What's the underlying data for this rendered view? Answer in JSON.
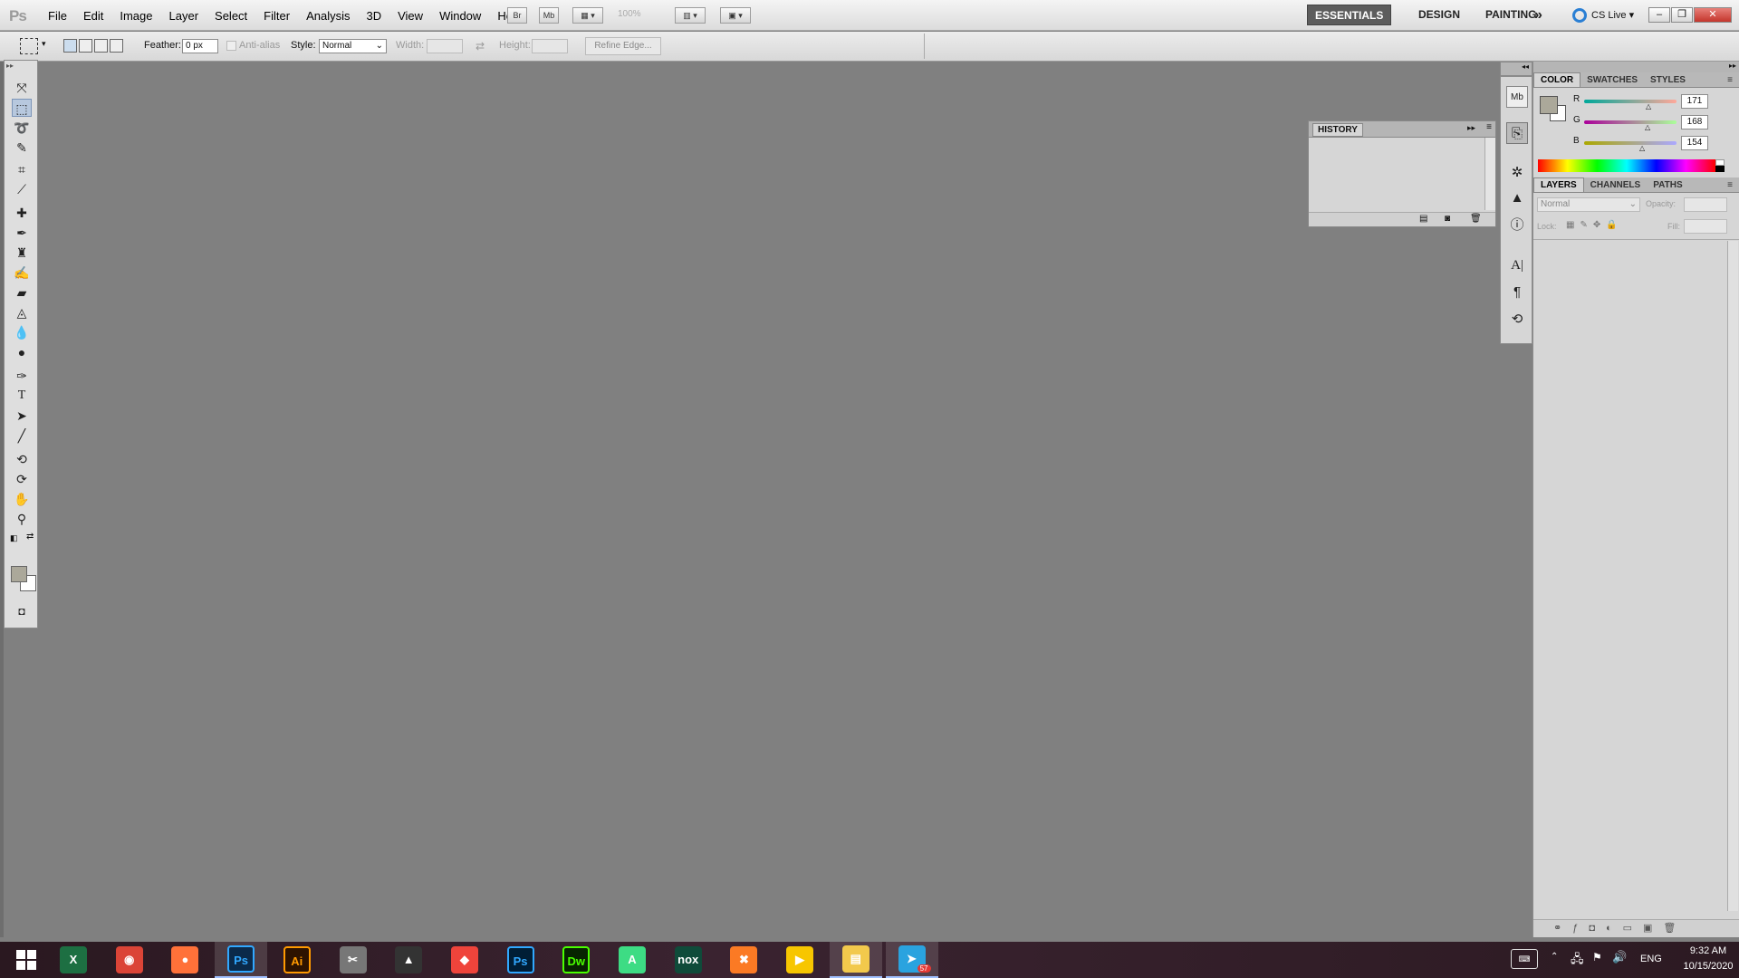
{
  "app": {
    "logo": "Ps"
  },
  "menu": [
    "File",
    "Edit",
    "Image",
    "Layer",
    "Select",
    "Filter",
    "Analysis",
    "3D",
    "View",
    "Window",
    "Help"
  ],
  "menubar_buttons": {
    "bridge": "Br",
    "mini_bridge": "Mb",
    "zoom": "100%"
  },
  "workspaces": {
    "essentials": "ESSENTIALS",
    "design": "DESIGN",
    "painting": "PAINTING",
    "more": "»",
    "cslive": "CS Live"
  },
  "options": {
    "feather_label": "Feather:",
    "feather_value": "0 px",
    "antialias_label": "Anti-alias",
    "style_label": "Style:",
    "style_value": "Normal",
    "width_label": "Width:",
    "height_label": "Height:",
    "refine_edge": "Refine Edge..."
  },
  "history_panel": {
    "title": "HISTORY"
  },
  "color_panel": {
    "tabs": [
      "COLOR",
      "SWATCHES",
      "STYLES"
    ],
    "channels": [
      {
        "label": "R",
        "value": "171"
      },
      {
        "label": "G",
        "value": "168"
      },
      {
        "label": "B",
        "value": "154"
      }
    ],
    "foreground": "#aba89a",
    "background": "#ffffff"
  },
  "layers_panel": {
    "tabs": [
      "LAYERS",
      "CHANNELS",
      "PATHS"
    ],
    "blend_mode": "Normal",
    "opacity_label": "Opacity:",
    "lock_label": "Lock:",
    "fill_label": "Fill:"
  },
  "taskbar": {
    "apps": [
      {
        "name": "Excel",
        "icon": "X",
        "color": "#1d6f42"
      },
      {
        "name": "Chrome",
        "icon": "◉",
        "color": "#db4437"
      },
      {
        "name": "Firefox",
        "icon": "●",
        "color": "#ff7139"
      },
      {
        "name": "Photoshop",
        "icon": "Ps",
        "color": "#0b2a4a"
      },
      {
        "name": "Illustrator",
        "icon": "Ai",
        "color": "#2d1300"
      },
      {
        "name": "Snipping Tool",
        "icon": "✂",
        "color": "#777777"
      },
      {
        "name": "Lighthouse",
        "icon": "▲",
        "color": "#333333"
      },
      {
        "name": "AnyDesk",
        "icon": "◆",
        "color": "#ef443b"
      },
      {
        "name": "Photoshop",
        "icon": "Ps",
        "color": "#001e36"
      },
      {
        "name": "Dreamweaver",
        "icon": "Dw",
        "color": "#072401"
      },
      {
        "name": "Android Studio",
        "icon": "A",
        "color": "#3ddc84"
      },
      {
        "name": "Nox",
        "icon": "nox",
        "color": "#0f4b3a"
      },
      {
        "name": "XAMPP",
        "icon": "✖",
        "color": "#fb7a24"
      },
      {
        "name": "Media Player",
        "icon": "▶",
        "color": "#f7c600"
      },
      {
        "name": "File Explorer",
        "icon": "▤",
        "color": "#f2c94c"
      },
      {
        "name": "Telegram",
        "icon": "➤",
        "color": "#2aa3df"
      }
    ],
    "telegram_badge": "57",
    "lang": "ENG",
    "time": "9:32 AM",
    "date": "10/15/2020"
  }
}
